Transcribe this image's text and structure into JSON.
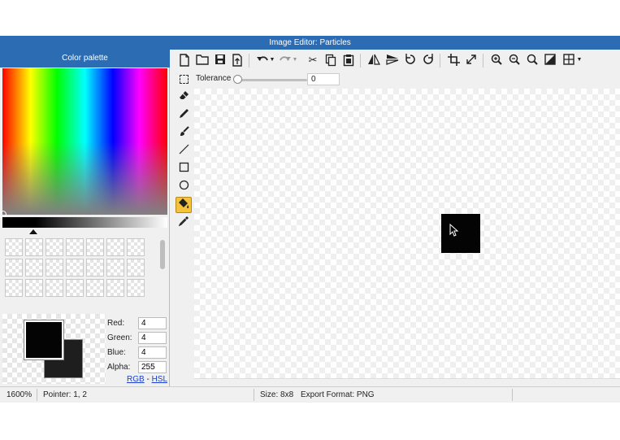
{
  "window": {
    "title": "Image Editor: Particles"
  },
  "palette": {
    "title": "Color palette",
    "primary_color": "#040404",
    "secondary_color": "#1e1e1e",
    "swatch_count": 21,
    "channels": [
      {
        "label": "Red:",
        "value": "4"
      },
      {
        "label": "Green:",
        "value": "4"
      },
      {
        "label": "Blue:",
        "value": "4"
      },
      {
        "label": "Alpha:",
        "value": "255"
      }
    ],
    "modes": {
      "rgb": "RGB",
      "separator": "-",
      "hsl": "HSL"
    }
  },
  "toolbar": {
    "icons": [
      "new-file-icon",
      "open-folder-icon",
      "save-icon",
      "export-icon",
      "undo-icon",
      "undo-dropdown-icon",
      "redo-icon",
      "redo-dropdown-icon",
      "cut-icon",
      "copy-icon",
      "paste-icon",
      "flip-horizontal-icon",
      "flip-vertical-icon",
      "rotate-left-icon",
      "rotate-right-icon",
      "crop-icon",
      "resize-icon",
      "zoom-in-icon",
      "zoom-out-icon",
      "zoom-fit-icon",
      "invert-icon",
      "grid-icon",
      "grid-dropdown-icon"
    ]
  },
  "options": {
    "tolerance_label": "Tolerance",
    "tolerance_value": "0",
    "tolerance_fraction": 0
  },
  "tools": {
    "items": [
      "select-icon",
      "eraser-icon",
      "pencil-icon",
      "brush-icon",
      "line-icon",
      "rectangle-icon",
      "ellipse-icon",
      "fill-bucket-icon",
      "eyedropper-icon"
    ],
    "active": "fill-bucket-icon"
  },
  "canvas": {
    "background": "transparent",
    "pixel_color": "#040404"
  },
  "status": {
    "zoom": "1600%",
    "pointer": "Pointer: 1, 2",
    "size": "Size: 8x8",
    "export_format": "Export Format: PNG"
  }
}
